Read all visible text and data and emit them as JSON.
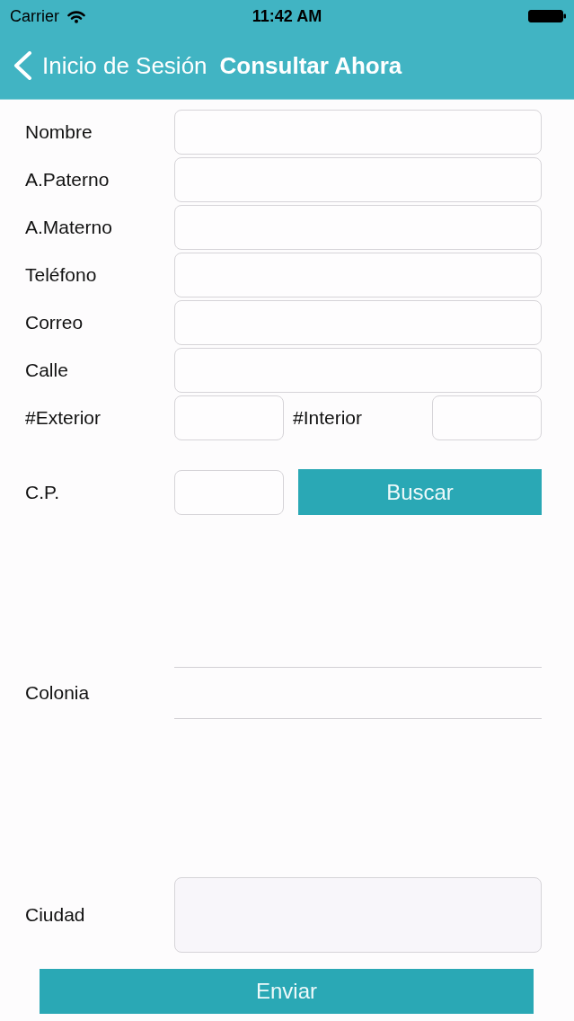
{
  "status_bar": {
    "carrier": "Carrier",
    "time": "11:42 AM"
  },
  "nav_bar": {
    "back_label": "Inicio de Sesión",
    "title": "Consultar Ahora"
  },
  "form": [
    {
      "kind": "text",
      "label": "Nombre"
    },
    {
      "kind": "text",
      "label": "A.Paterno"
    },
    {
      "kind": "text",
      "label": "A.Materno"
    },
    {
      "kind": "text",
      "label": "Teléfono"
    },
    {
      "kind": "text",
      "label": "Correo"
    },
    {
      "kind": "text",
      "label": "Calle"
    },
    {
      "kind": "pair",
      "label": "#Exterior",
      "second_label": "#Interior"
    },
    {
      "kind": "search",
      "label": "C.P.",
      "button": "Buscar"
    },
    {
      "kind": "picker",
      "label": "Colonia"
    },
    {
      "kind": "area",
      "label": "Ciudad"
    }
  ],
  "submit_button": "Enviar"
}
